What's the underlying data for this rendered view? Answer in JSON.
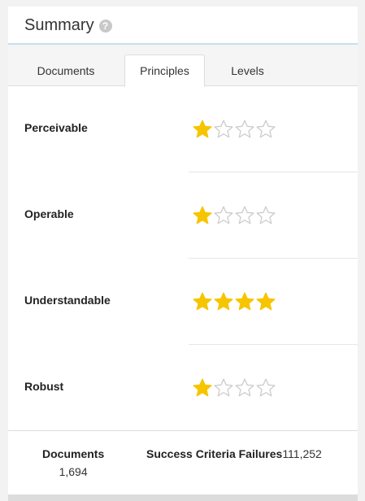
{
  "header": {
    "title": "Summary",
    "help_icon": "question-circle-icon"
  },
  "tabs": [
    {
      "label": "Documents",
      "active": false
    },
    {
      "label": "Principles",
      "active": true
    },
    {
      "label": "Levels",
      "active": false
    }
  ],
  "principles": [
    {
      "label": "Perceivable",
      "rating": 1,
      "max_rating": 4
    },
    {
      "label": "Operable",
      "rating": 1,
      "max_rating": 4
    },
    {
      "label": "Understandable",
      "rating": 4,
      "max_rating": 4
    },
    {
      "label": "Robust",
      "rating": 1,
      "max_rating": 4
    }
  ],
  "footer": {
    "documents_label": "Documents",
    "documents_value": "1,694",
    "failures_label": "Success Criteria Failures",
    "failures_value": "111,252"
  },
  "colors": {
    "star_filled": "#f6c500",
    "star_empty_stroke": "#cccccc",
    "header_underline": "#c9dfee"
  }
}
